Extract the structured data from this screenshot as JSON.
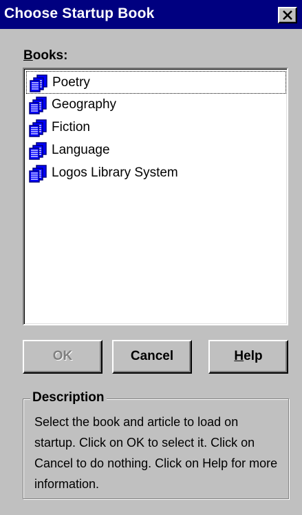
{
  "window": {
    "title": "Choose Startup Book",
    "close_icon": "close-icon"
  },
  "books": {
    "label_mnemonic": "B",
    "label_rest": "ooks:",
    "items": [
      {
        "label": "Poetry",
        "icon": "book-stack-icon",
        "selected": true
      },
      {
        "label": "Geography",
        "icon": "book-stack-icon",
        "selected": false
      },
      {
        "label": "Fiction",
        "icon": "book-stack-icon",
        "selected": false
      },
      {
        "label": "Language",
        "icon": "book-stack-icon",
        "selected": false
      },
      {
        "label": "Logos Library System",
        "icon": "book-stack-icon",
        "selected": false
      }
    ]
  },
  "buttons": {
    "ok_label": "OK",
    "ok_enabled": false,
    "cancel_label": "Cancel",
    "help_mnemonic": "H",
    "help_rest": "elp"
  },
  "description": {
    "title": "Description",
    "text": "Select the book and article to load on startup. Click on OK to select it. Click on Cancel to do nothing. Click on Help for more information."
  },
  "colors": {
    "titlebar": "#000080",
    "face": "#c0c0c0",
    "icon_blue": "#0000ff",
    "icon_dark": "#000080"
  }
}
